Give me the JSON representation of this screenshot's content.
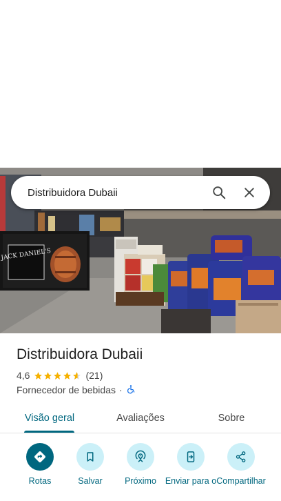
{
  "search": {
    "query": "Distribuidora Dubaii",
    "search_icon": "search-icon",
    "clear_icon": "close-icon"
  },
  "place": {
    "name": "Distribuidora Dubaii",
    "rating": "4,6",
    "rating_value": 4.6,
    "rating_max": 5,
    "review_count": "(21)",
    "category": "Fornecedor de bebidas",
    "separator": "·",
    "accessibility_icon": "wheelchair-icon"
  },
  "tabs": [
    {
      "label": "Visão geral",
      "active": true
    },
    {
      "label": "Avaliações",
      "active": false
    },
    {
      "label": "Sobre",
      "active": false
    }
  ],
  "actions": [
    {
      "label": "Rotas",
      "icon": "directions-icon",
      "primary": true
    },
    {
      "label": "Salvar",
      "icon": "bookmark-icon",
      "primary": false
    },
    {
      "label": "Próximo",
      "icon": "nearby-icon",
      "primary": false
    },
    {
      "label": "Enviar para o",
      "icon": "send-to-phone-icon",
      "primary": false
    },
    {
      "label": "Compartilhar",
      "icon": "share-icon",
      "primary": false
    }
  ],
  "colors": {
    "accent": "#00677f",
    "action_bg": "#cbf0f8",
    "star": "#f6b100"
  },
  "hero": {
    "sign_text": "JACK DANIEL'S"
  }
}
